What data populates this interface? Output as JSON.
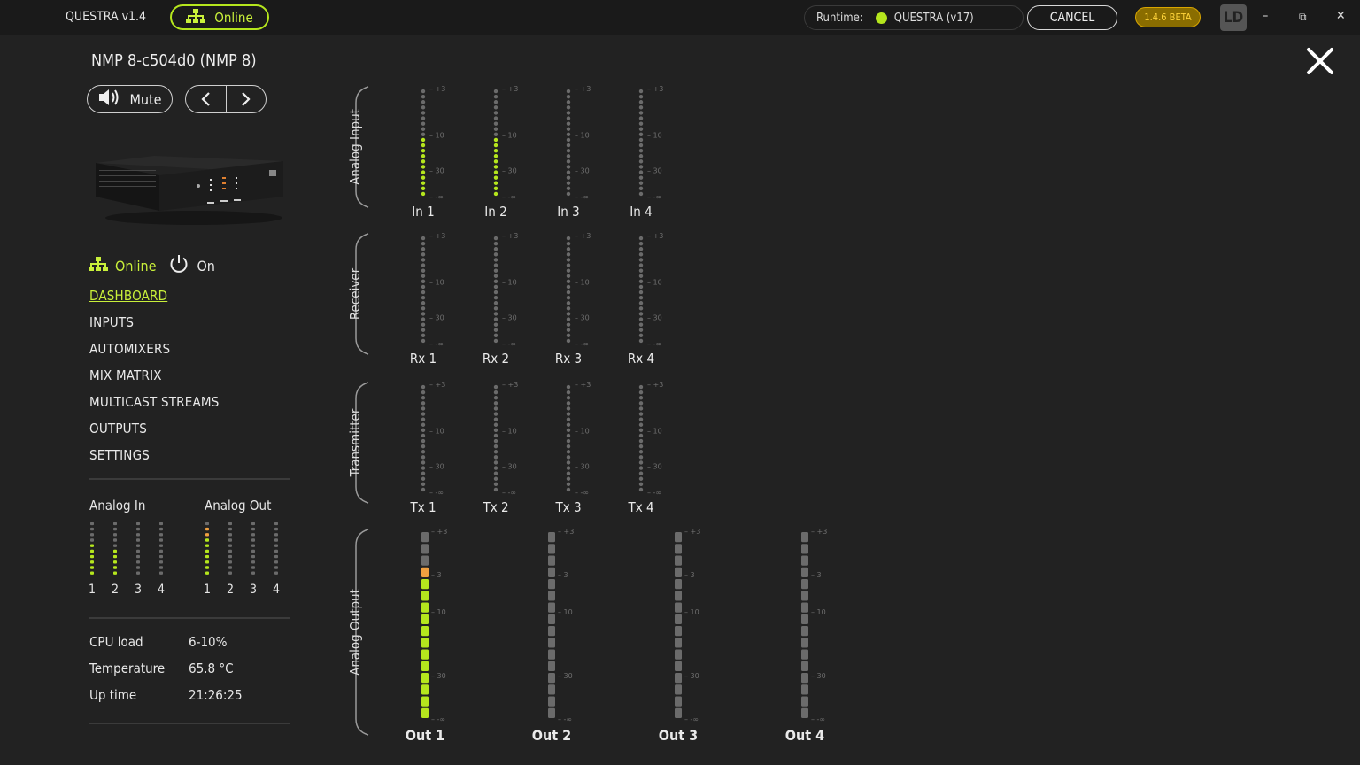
{
  "titlebar": {
    "app_title": "QUESTRA v1.4",
    "online_label": "Online",
    "runtime_label": "Runtime:",
    "runtime_value": "QUESTRA (v17)",
    "cancel_label": "CANCEL",
    "beta_label": "1.4.6 BETA",
    "profile_initials": "LD",
    "minimize": "–",
    "maximize": "⧉",
    "close": "✕"
  },
  "device": {
    "name": "NMP 8-c504d0 (NMP 8)",
    "mute_label": "Mute",
    "status_online": "Online",
    "status_power": "On"
  },
  "menu": [
    "DASHBOARD",
    "INPUTS",
    "AUTOMIXERS",
    "MIX MATRIX",
    "MULTICAST STREAMS",
    "OUTPUTS",
    "SETTINGS"
  ],
  "mini_meters": {
    "analog_in_label": "Analog In",
    "analog_out_label": "Analog Out",
    "analog_in": [
      {
        "label": "1",
        "level": 0.55
      },
      {
        "label": "2",
        "level": 0.45
      },
      {
        "label": "3",
        "level": 0
      },
      {
        "label": "4",
        "level": 0
      }
    ],
    "analog_out": [
      {
        "label": "1",
        "level": 0.85
      },
      {
        "label": "2",
        "level": 0
      },
      {
        "label": "3",
        "level": 0
      },
      {
        "label": "4",
        "level": 0
      }
    ]
  },
  "stats": {
    "cpu_label": "CPU load",
    "cpu_value": "6-10%",
    "temp_label": "Temperature",
    "temp_value": "65.8 °C",
    "uptime_label": "Up time",
    "uptime_value": "21:26:25"
  },
  "meter_ticks": [
    "+3",
    "10",
    "30",
    "-∞"
  ],
  "out_meter_ticks": [
    "+3",
    "3",
    "10",
    "30",
    "-∞"
  ],
  "sections": [
    {
      "label": "Analog Input",
      "channels": [
        {
          "label": "In 1",
          "level": 0.57
        },
        {
          "label": "In 2",
          "level": 0.57
        },
        {
          "label": "In 3",
          "level": 0
        },
        {
          "label": "In 4",
          "level": 0
        }
      ]
    },
    {
      "label": "Receiver",
      "channels": [
        {
          "label": "Rx 1",
          "level": 0
        },
        {
          "label": "Rx 2",
          "level": 0
        },
        {
          "label": "Rx 3",
          "level": 0
        },
        {
          "label": "Rx 4",
          "level": 0
        }
      ]
    },
    {
      "label": "Transmitter",
      "channels": [
        {
          "label": "Tx 1",
          "level": 0
        },
        {
          "label": "Tx 2",
          "level": 0
        },
        {
          "label": "Tx 3",
          "level": 0
        },
        {
          "label": "Tx 4",
          "level": 0
        }
      ]
    },
    {
      "label": "Analog Output",
      "channels": [
        {
          "label": "Out 1",
          "level": 0.83
        },
        {
          "label": "Out 2",
          "level": 0
        },
        {
          "label": "Out 3",
          "level": 0
        },
        {
          "label": "Out 4",
          "level": 0
        }
      ]
    }
  ],
  "colors": {
    "accent": "#b5e61d",
    "warn": "#f0a040",
    "inactive": "#6b6b6b",
    "background": "#222222",
    "titlebar": "#1a1a1a"
  }
}
